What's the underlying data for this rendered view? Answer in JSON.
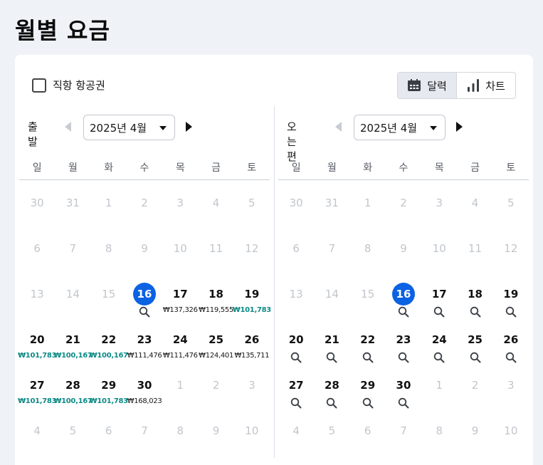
{
  "page": {
    "title": "월별 요금"
  },
  "filter": {
    "direct_label": "직항 항공권"
  },
  "view_toggle": {
    "calendar_label": "달력",
    "chart_label": "차트",
    "active": "calendar"
  },
  "weekdays": [
    "일",
    "월",
    "화",
    "수",
    "목",
    "금",
    "토"
  ],
  "outbound": {
    "label": "출발",
    "month": "2025년 4월",
    "weeks": [
      [
        {
          "d": "30",
          "m": true
        },
        {
          "d": "31",
          "m": true
        },
        {
          "d": "1",
          "m": true
        },
        {
          "d": "2",
          "m": true
        },
        {
          "d": "3",
          "m": true
        },
        {
          "d": "4",
          "m": true
        },
        {
          "d": "5",
          "m": true
        }
      ],
      [
        {
          "d": "6",
          "m": true
        },
        {
          "d": "7",
          "m": true
        },
        {
          "d": "8",
          "m": true
        },
        {
          "d": "9",
          "m": true
        },
        {
          "d": "10",
          "m": true
        },
        {
          "d": "11",
          "m": true
        },
        {
          "d": "12",
          "m": true
        }
      ],
      [
        {
          "d": "13",
          "m": true
        },
        {
          "d": "14",
          "m": true
        },
        {
          "d": "15",
          "m": true
        },
        {
          "d": "16",
          "today": true,
          "search": true
        },
        {
          "d": "17",
          "p": "₩137,326"
        },
        {
          "d": "18",
          "p": "₩119,555"
        },
        {
          "d": "19",
          "p": "₩101,783",
          "cheap": true
        }
      ],
      [
        {
          "d": "20",
          "p": "₩101,783",
          "cheap": true
        },
        {
          "d": "21",
          "p": "₩100,167",
          "cheap": true
        },
        {
          "d": "22",
          "p": "₩100,167",
          "cheap": true
        },
        {
          "d": "23",
          "p": "₩111,476"
        },
        {
          "d": "24",
          "p": "₩111,476"
        },
        {
          "d": "25",
          "p": "₩124,401"
        },
        {
          "d": "26",
          "p": "₩135,711"
        }
      ],
      [
        {
          "d": "27",
          "p": "₩101,783",
          "cheap": true
        },
        {
          "d": "28",
          "p": "₩100,167",
          "cheap": true
        },
        {
          "d": "29",
          "p": "₩101,783",
          "cheap": true
        },
        {
          "d": "30",
          "p": "₩168,023"
        },
        {
          "d": "1",
          "m": true
        },
        {
          "d": "2",
          "m": true
        },
        {
          "d": "3",
          "m": true
        }
      ],
      [
        {
          "d": "4",
          "m": true
        },
        {
          "d": "5",
          "m": true
        },
        {
          "d": "6",
          "m": true
        },
        {
          "d": "7",
          "m": true
        },
        {
          "d": "8",
          "m": true
        },
        {
          "d": "9",
          "m": true
        },
        {
          "d": "10",
          "m": true
        }
      ]
    ]
  },
  "return": {
    "label": "오는편",
    "month": "2025년 4월",
    "weeks": [
      [
        {
          "d": "30",
          "m": true
        },
        {
          "d": "31",
          "m": true
        },
        {
          "d": "1",
          "m": true
        },
        {
          "d": "2",
          "m": true
        },
        {
          "d": "3",
          "m": true
        },
        {
          "d": "4",
          "m": true
        },
        {
          "d": "5",
          "m": true
        }
      ],
      [
        {
          "d": "6",
          "m": true
        },
        {
          "d": "7",
          "m": true
        },
        {
          "d": "8",
          "m": true
        },
        {
          "d": "9",
          "m": true
        },
        {
          "d": "10",
          "m": true
        },
        {
          "d": "11",
          "m": true
        },
        {
          "d": "12",
          "m": true
        }
      ],
      [
        {
          "d": "13",
          "m": true
        },
        {
          "d": "14",
          "m": true
        },
        {
          "d": "15",
          "m": true
        },
        {
          "d": "16",
          "today": true,
          "search": true
        },
        {
          "d": "17",
          "search": true
        },
        {
          "d": "18",
          "search": true
        },
        {
          "d": "19",
          "search": true
        }
      ],
      [
        {
          "d": "20",
          "search": true
        },
        {
          "d": "21",
          "search": true
        },
        {
          "d": "22",
          "search": true
        },
        {
          "d": "23",
          "search": true
        },
        {
          "d": "24",
          "search": true
        },
        {
          "d": "25",
          "search": true
        },
        {
          "d": "26",
          "search": true
        }
      ],
      [
        {
          "d": "27",
          "search": true
        },
        {
          "d": "28",
          "search": true
        },
        {
          "d": "29",
          "search": true
        },
        {
          "d": "30",
          "search": true
        },
        {
          "d": "1",
          "m": true
        },
        {
          "d": "2",
          "m": true
        },
        {
          "d": "3",
          "m": true
        }
      ],
      [
        {
          "d": "4",
          "m": true
        },
        {
          "d": "5",
          "m": true
        },
        {
          "d": "6",
          "m": true
        },
        {
          "d": "7",
          "m": true
        },
        {
          "d": "8",
          "m": true
        },
        {
          "d": "9",
          "m": true
        },
        {
          "d": "10",
          "m": true
        }
      ]
    ]
  },
  "colors": {
    "today": "#0b62e3",
    "cheap_price": "#0c8a86",
    "muted_day": "#c1c6cc",
    "page_bg": "#eff3f8"
  },
  "icons": {
    "calendar": "calendar-icon",
    "chart": "bar-chart-icon",
    "search": "search-icon",
    "prev": "prev-month-icon",
    "next": "next-month-icon",
    "dropdown": "chevron-down-icon"
  }
}
